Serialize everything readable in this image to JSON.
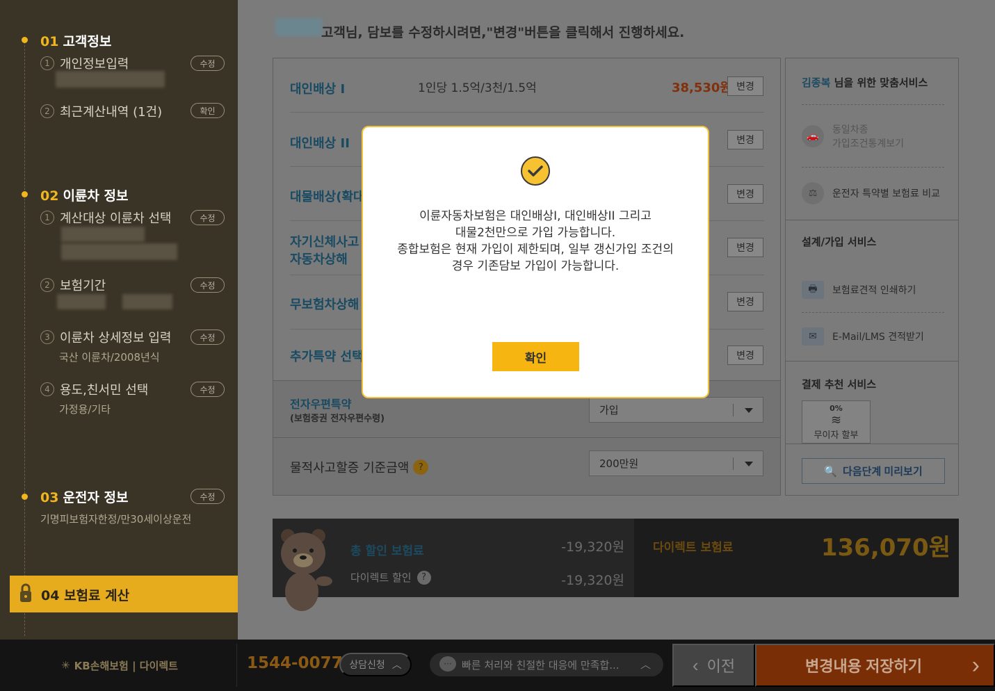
{
  "sidebar": {
    "step1": {
      "num": "01",
      "title": "고객정보",
      "items": [
        {
          "num": "1",
          "label": "개인정보입력",
          "btn": "수정"
        },
        {
          "num": "2",
          "label": "최근계산내역  (1건)",
          "btn": "확인"
        }
      ]
    },
    "step2": {
      "num": "02",
      "title": "이륜차 정보",
      "items": [
        {
          "num": "1",
          "label": "계산대상 이륜차 선택",
          "btn": "수정"
        },
        {
          "num": "2",
          "label": "보험기간",
          "btn": "수정"
        },
        {
          "num": "3",
          "label": "이륜차 상세정보 입력",
          "btn": "수정",
          "detail": "국산 이륜차/2008년식"
        },
        {
          "num": "4",
          "label": "용도,친서민 선택",
          "btn": "수정",
          "detail": "가정용/기타"
        }
      ]
    },
    "step3": {
      "num": "03",
      "title": "운전자 정보",
      "btn": "수정",
      "detail": "기명피보험자한정/만30세이상운전"
    },
    "step4": {
      "num": "04",
      "title": "보험료 계산"
    }
  },
  "main": {
    "headline": "고객님, 담보를 수정하시려면,\"변경\"버튼을 클릭해서 진행하세요.",
    "rows": [
      {
        "label": "대인배상 I",
        "desc": "1인당 1.5억/3천/1.5억",
        "price": "38,530원",
        "btn": "변경"
      },
      {
        "label": "대인배상 II",
        "btn": "변경"
      },
      {
        "label": "대물배상(확대",
        "btn": "변경"
      },
      {
        "label": "자기신체사고",
        "label2": "자동차상해",
        "btn": "변경"
      },
      {
        "label": "무보험차상해",
        "btn": "변경"
      },
      {
        "label": "추가특약 선택",
        "btn": "변경"
      }
    ],
    "ecert": {
      "label": "전자우편특약",
      "sub": "(보험증권 전자우편수령)",
      "value": "가입"
    },
    "property": {
      "label": "물적사고할증 기준금액",
      "help": "?",
      "value": "200만원"
    }
  },
  "right_panel": {
    "user_name": "김종복",
    "user_suffix": " 님을 위한 맞춤서비스",
    "items1": [
      {
        "label": "동일차종",
        "label2": "가입조건통계보기",
        "icon": "car-icon"
      },
      {
        "label": "운전자 특약별 보험료 비교",
        "icon": "compare-icon"
      }
    ],
    "section2": "설계/가입 서비스",
    "items2": [
      {
        "label": "보험료견적 인쇄하기",
        "icon": "printer-icon"
      },
      {
        "label": "E-Mail/LMS 견적받기",
        "icon": "mail-icon"
      }
    ],
    "section3": "결제 추천 서비스",
    "installment": "무이자 할부",
    "installment_tag": "0%",
    "preview": "다음단계 미리보기"
  },
  "summary": {
    "total_discount_label": "총 할인 보험료",
    "total_discount": "-19,320원",
    "direct_discount_label": "다이렉트 할인",
    "direct_discount": "-19,320원",
    "direct_premium_label": "다이렉트 보험료",
    "direct_premium": "136,070원"
  },
  "footer": {
    "brand": "KB손해보험 | 다이렉트",
    "phone": "1544-0077",
    "consult": "상담신청",
    "chat": "빠른 처리와 친절한 대응에 만족합...",
    "prev": "이전",
    "save": "변경내용 저장하기"
  },
  "modal": {
    "line1": "이륜자동차보험은 대인배상I, 대인배상II 그리고",
    "line2": "대물2천만으로 가입 가능합니다.",
    "line3": "종합보험은 현재 가입이 제한되며, 일부 갱신가입 조건의",
    "line4": "경우 기존담보 가입이 가능합니다.",
    "ok": "확인"
  },
  "colors": {
    "accent": "#f7b512",
    "price": "#e0541a",
    "link": "#1f86b3"
  }
}
